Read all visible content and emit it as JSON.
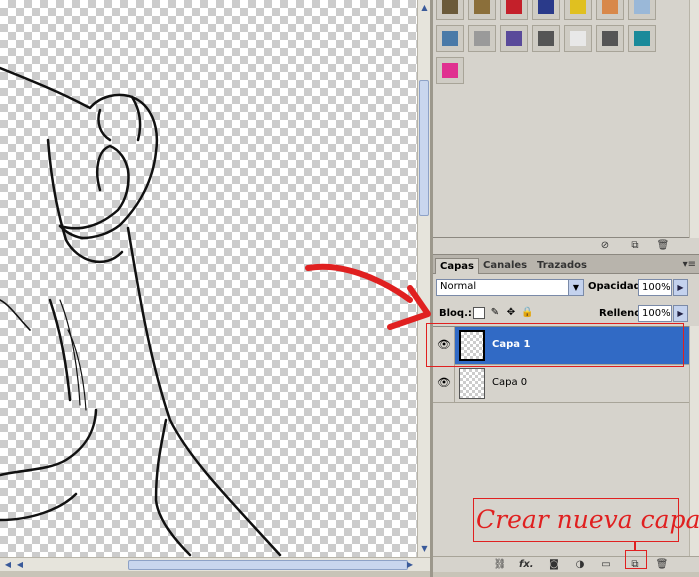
{
  "swatch_colors": [
    "#6b5a3a",
    "#8b6f3a",
    "#c4202a",
    "#2a3a8a",
    "#e0c020",
    "#d8884a",
    "#9ab8d8",
    "#4a7aa8",
    "#9a9a9a",
    "#5a4a9a",
    "#555555",
    "#e8e8e8",
    "#555555",
    "#1a8a9a",
    "#e03090"
  ],
  "layers_panel": {
    "tabs": [
      "Capas",
      "Canales",
      "Trazados"
    ],
    "menu_icon": "panel-menu-icon",
    "blend_mode": "Normal",
    "opacity_label": "Opacidad:",
    "opacity_value": "100%",
    "lock_label": "Bloq.:",
    "fill_label": "Relleno:",
    "fill_value": "100%",
    "layers": [
      {
        "name": "Capa 1",
        "selected": true
      },
      {
        "name": "Capa 0",
        "selected": false
      }
    ],
    "footer_icons": [
      "link-icon",
      "fx-icon",
      "mask-icon",
      "adjustment-icon",
      "folder-icon",
      "new-layer-icon",
      "trash-icon"
    ]
  },
  "swatch_footer_icons": [
    "delete-icon",
    "new-swatch-icon",
    "trash-icon"
  ],
  "annotation": {
    "callout": "Crear nueva capa",
    "accent_color": "#e02020"
  }
}
